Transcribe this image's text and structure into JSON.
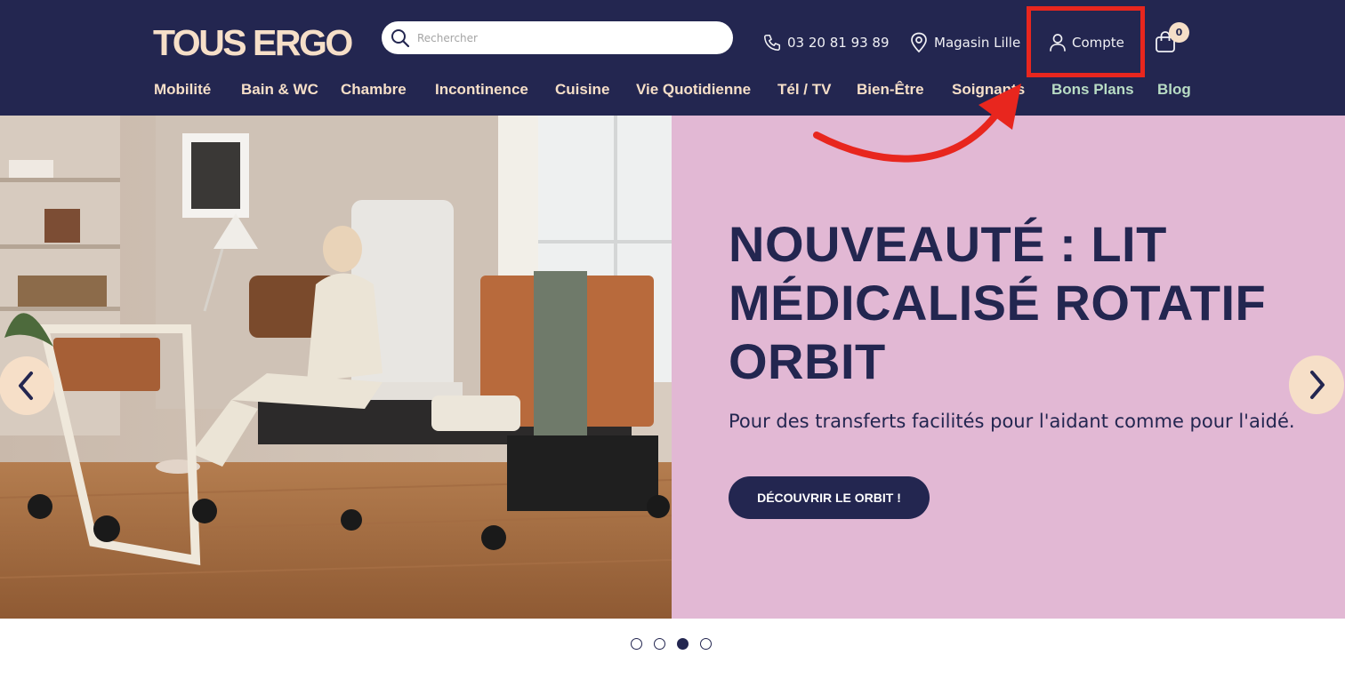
{
  "header": {
    "logo": "TOUS ERGO",
    "search": {
      "placeholder": "Rechercher",
      "value": ""
    },
    "phone": "03 20 81 93 89",
    "store": "Magasin Lille",
    "account": "Compte",
    "cart_count": "0"
  },
  "nav": {
    "items": [
      {
        "label": "Mobilité"
      },
      {
        "label": "Bain & WC"
      },
      {
        "label": "Chambre"
      },
      {
        "label": "Incontinence"
      },
      {
        "label": "Cuisine"
      },
      {
        "label": "Vie Quotidienne"
      },
      {
        "label": "Tél / TV"
      },
      {
        "label": "Bien-Être"
      },
      {
        "label": "Soignants"
      },
      {
        "label": "Bons Plans"
      },
      {
        "label": "Blog"
      }
    ]
  },
  "hero": {
    "title": "NOUVEAUTÉ : LIT MÉDICALISÉ ROTATIF ORBIT",
    "subtitle": "Pour des transferts facilités pour l'aidant comme pour l'aidé.",
    "cta": "DÉCOUVRIR LE ORBIT !"
  },
  "carousel": {
    "slide_count": 4,
    "active_slide": 3
  },
  "colors": {
    "navy": "#232650",
    "cream": "#f6dfc8",
    "green": "#b8dcc4",
    "pink": "#e2b8d4",
    "annotation_red": "#e8261e"
  },
  "icons": [
    "search-icon",
    "phone-icon",
    "location-pin-icon",
    "user-icon",
    "shopping-bag-icon",
    "chevron-left-icon",
    "chevron-right-icon"
  ]
}
